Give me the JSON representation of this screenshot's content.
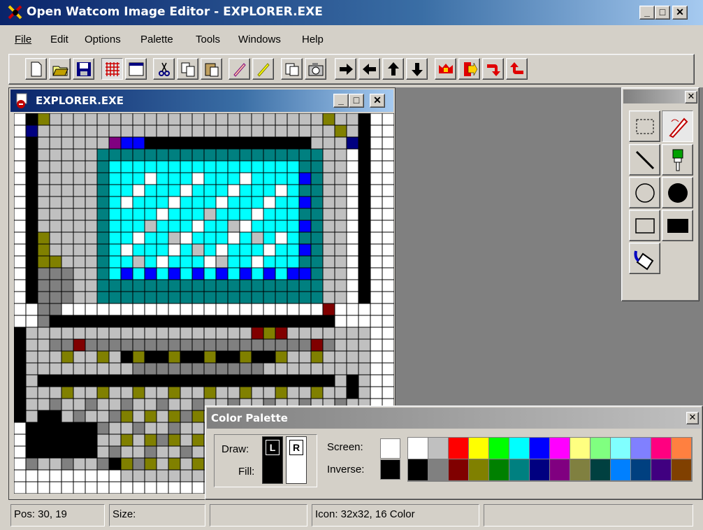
{
  "window": {
    "title": "Open Watcom Image Editor - EXPLORER.EXE"
  },
  "menu": [
    "File",
    "Edit",
    "Options",
    "Palette",
    "Tools",
    "Windows",
    "Help"
  ],
  "menu_mnemonic_index": [
    0,
    0,
    0,
    0,
    0,
    0,
    0
  ],
  "toolbar": {
    "buttons": [
      "new-icon",
      "open-icon",
      "save-icon",
      "grid-icon",
      "view-icon",
      "cut-icon",
      "copy-icon",
      "paste-icon",
      "pencil-icon",
      "pen-icon",
      "snap-icon",
      "camera-icon",
      "shift-right-icon",
      "shift-left-icon",
      "shift-up-icon",
      "shift-down-icon",
      "flip-horizontal-icon",
      "flip-vertical-icon",
      "rotate-clockwise-icon",
      "rotate-counterclockwise-icon"
    ]
  },
  "image_window": {
    "title": "EXPLORER.EXE"
  },
  "tools": [
    "select-rect-icon",
    "pencil-tool-icon",
    "line-icon",
    "brush-icon",
    "ellipse-icon",
    "filled-ellipse-icon",
    "rect-icon",
    "filled-rect-icon",
    "fill-icon"
  ],
  "color_palette": {
    "title": "Color Palette",
    "draw_label": "Draw:",
    "fill_label": "Fill:",
    "left_label": "L",
    "right_label": "R",
    "screen_label": "Screen:",
    "inverse_label": "Inverse:",
    "row1": [
      "#ffffff",
      "#c0c0c0",
      "#ff0000",
      "#ffff00",
      "#00ff00",
      "#00ffff",
      "#0000ff",
      "#ff00ff",
      "#ffff80",
      "#80ff80",
      "#80ffff",
      "#8080ff",
      "#ff0080",
      "#ff8040"
    ],
    "row2": [
      "#000000",
      "#808080",
      "#800000",
      "#808000",
      "#008000",
      "#008080",
      "#000080",
      "#800080",
      "#808040",
      "#004040",
      "#0080ff",
      "#004080",
      "#400080",
      "#804000"
    ]
  },
  "status": {
    "pos": "Pos: 30, 19",
    "size": "Size:",
    "empty1": "",
    "icon": "Icon: 32x32, 16 Color",
    "empty2": ""
  }
}
